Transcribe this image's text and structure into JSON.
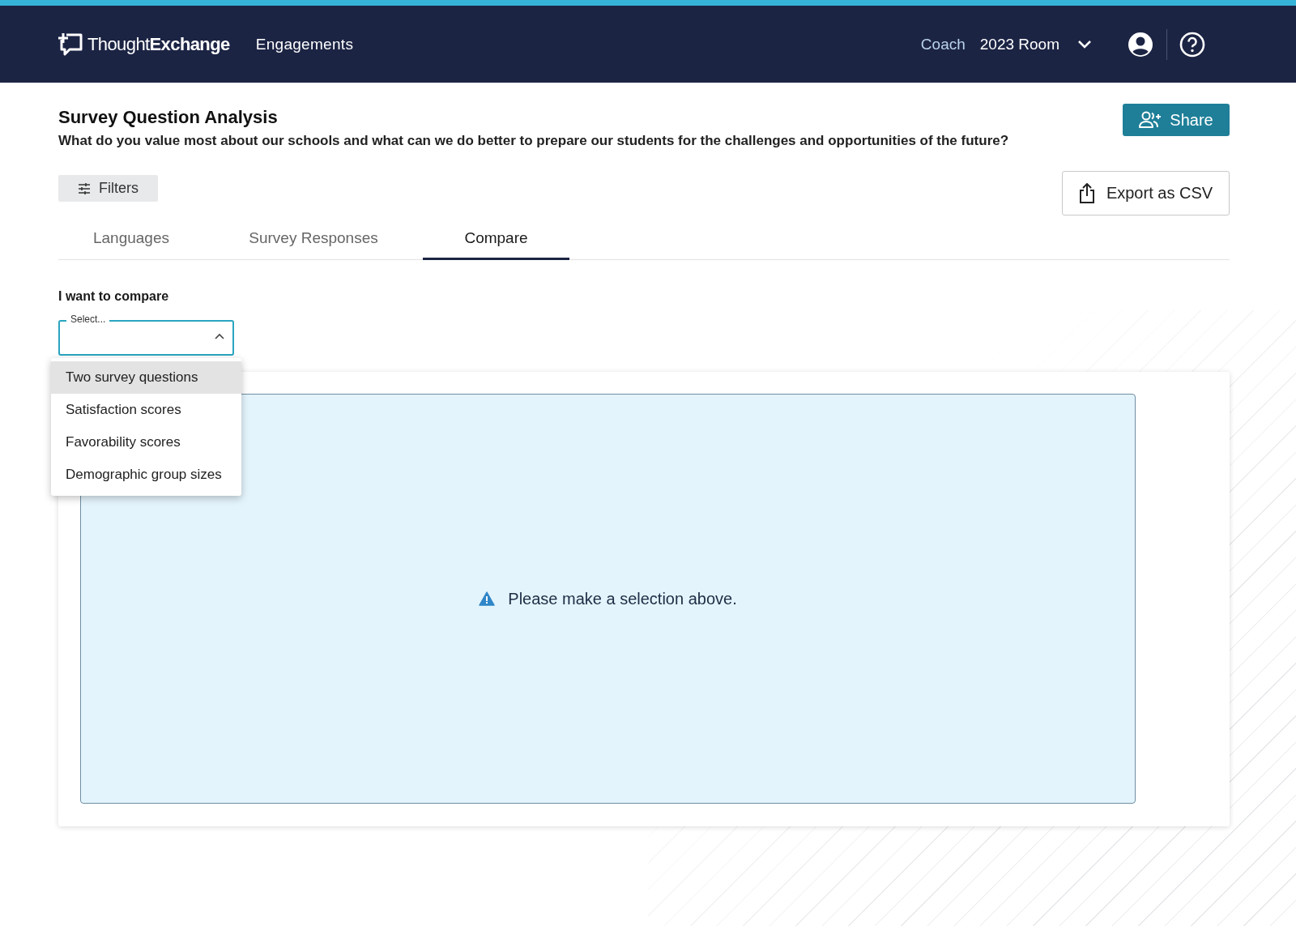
{
  "header": {
    "logo": "Thought**Exchange**",
    "nav": "Engagements",
    "coach": "Coach",
    "room": "2023 Room"
  },
  "page": {
    "title": "Survey Question Analysis",
    "question": "What do you value most about our schools and what can we do better to prepare our students for the challenges and opportunities of the future?",
    "share_button": "Share",
    "filters_button": "Filters",
    "export_button": "Export as CSV"
  },
  "tabs": [
    {
      "label": "Languages",
      "selected": false
    },
    {
      "label": "Survey Responses",
      "selected": false
    },
    {
      "label": "Compare",
      "selected": true
    }
  ],
  "compare": {
    "label": "I want to compare",
    "select": {
      "placeholder": "Select...",
      "expanded": true
    },
    "options": [
      {
        "label": "Two survey questions",
        "selected": true
      },
      {
        "label": "Satisfaction scores",
        "selected": false
      },
      {
        "label": "Favorability scores",
        "selected": false
      },
      {
        "label": "Demographic group sizes",
        "selected": false
      }
    ]
  },
  "notice": "Please make a selection above."
}
